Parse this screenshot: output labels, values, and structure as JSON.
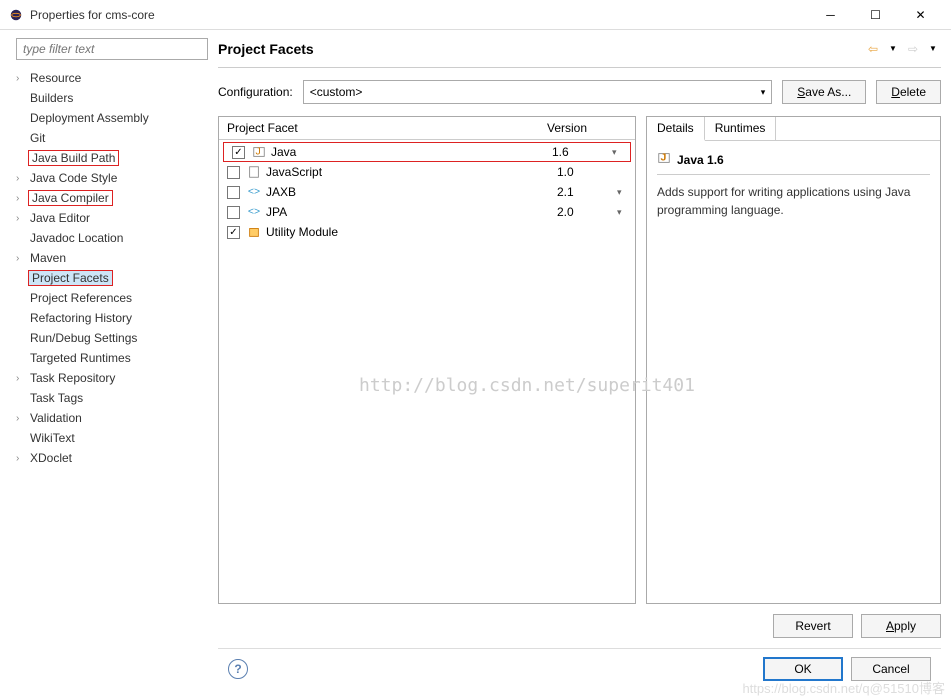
{
  "window": {
    "title": "Properties for cms-core"
  },
  "filter": {
    "placeholder": "type filter text"
  },
  "sidebar": {
    "items": [
      {
        "label": "Resource",
        "expandable": true
      },
      {
        "label": "Builders"
      },
      {
        "label": "Deployment Assembly"
      },
      {
        "label": "Git"
      },
      {
        "label": "Java Build Path",
        "highlight": "red"
      },
      {
        "label": "Java Code Style",
        "expandable": true
      },
      {
        "label": "Java Compiler",
        "expandable": true,
        "highlight": "red"
      },
      {
        "label": "Java Editor",
        "expandable": true
      },
      {
        "label": "Javadoc Location"
      },
      {
        "label": "Maven",
        "expandable": true
      },
      {
        "label": "Project Facets",
        "highlight": "selected-red"
      },
      {
        "label": "Project References"
      },
      {
        "label": "Refactoring History"
      },
      {
        "label": "Run/Debug Settings"
      },
      {
        "label": "Targeted Runtimes"
      },
      {
        "label": "Task Repository",
        "expandable": true
      },
      {
        "label": "Task Tags"
      },
      {
        "label": "Validation",
        "expandable": true
      },
      {
        "label": "WikiText"
      },
      {
        "label": "XDoclet",
        "expandable": true
      }
    ]
  },
  "content": {
    "heading": "Project Facets",
    "config_label": "Configuration:",
    "config_value": "<custom>",
    "save_as": "Save As...",
    "delete": "Delete"
  },
  "facets": {
    "col_name": "Project Facet",
    "col_version": "Version",
    "rows": [
      {
        "checked": true,
        "name": "Java",
        "version": "1.6",
        "caret": true,
        "icon": "java",
        "highlight": true
      },
      {
        "checked": false,
        "name": "JavaScript",
        "version": "1.0",
        "icon": "doc"
      },
      {
        "checked": false,
        "name": "JAXB",
        "version": "2.1",
        "caret": true,
        "icon": "jaxb"
      },
      {
        "checked": false,
        "name": "JPA",
        "version": "2.0",
        "caret": true,
        "icon": "jpa"
      },
      {
        "checked": true,
        "name": "Utility Module",
        "version": "",
        "icon": "jar"
      }
    ]
  },
  "details": {
    "tab_details": "Details",
    "tab_runtimes": "Runtimes",
    "title": "Java 1.6",
    "description": "Adds support for writing applications using Java programming language."
  },
  "buttons": {
    "revert": "Revert",
    "apply": "Apply",
    "ok": "OK",
    "cancel": "Cancel"
  },
  "watermark": "http://blog.csdn.net/superit401",
  "watermark2": "https://blog.csdn.net/q@51510博客"
}
